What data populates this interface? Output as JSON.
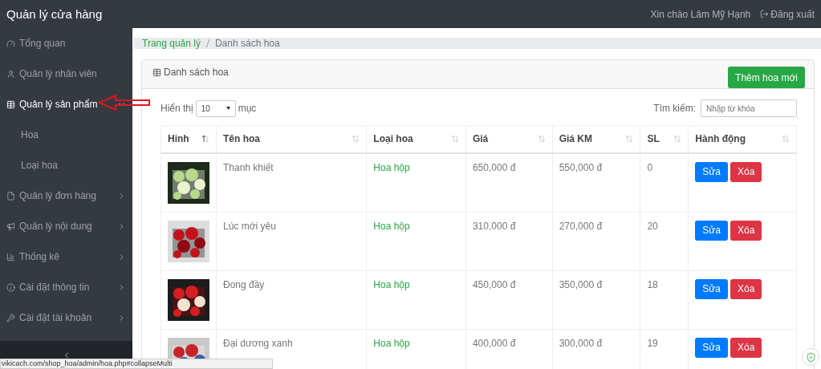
{
  "app": {
    "title": "Quản lý cửa hàng"
  },
  "top_bar": {
    "greeting": "Xin chào Lâm Mỹ Hạnh",
    "logout": "Đăng xuất"
  },
  "sidebar": {
    "items": [
      {
        "label": "Tổng quan",
        "kind": "link",
        "expanded": false
      },
      {
        "label": "Quản lý nhân viên",
        "kind": "link",
        "expanded": false
      },
      {
        "label": "Quản lý sản phẩm",
        "kind": "group",
        "expanded": true,
        "children": [
          {
            "label": "Hoa"
          },
          {
            "label": "Loại hoa"
          }
        ]
      },
      {
        "label": "Quản lý đơn hàng",
        "kind": "group",
        "expanded": false
      },
      {
        "label": "Quản lý nội dung",
        "kind": "group",
        "expanded": false
      },
      {
        "label": "Thống kê",
        "kind": "group",
        "expanded": false
      },
      {
        "label": "Cài đặt thông tin",
        "kind": "group",
        "expanded": false
      },
      {
        "label": "Cài đặt tài khoản",
        "kind": "group",
        "expanded": false
      }
    ]
  },
  "breadcrumb": [
    {
      "label": "Trang quản lý",
      "kind": "link"
    },
    {
      "label": "Danh sách hoa",
      "kind": "current"
    }
  ],
  "card": {
    "title": "Danh sách hoa",
    "add_button": "Thêm hoa mới"
  },
  "table_controls": {
    "show_label": "Hiển thị",
    "page_size": "10",
    "entries_label": "mục",
    "search_label": "Tìm kiếm:",
    "search_placeholder": "Nhập từ khóa"
  },
  "table": {
    "columns": [
      {
        "label": "Hinh",
        "sorted": true
      },
      {
        "label": "Tên hoa",
        "sorted": false
      },
      {
        "label": "Loại hoa",
        "sorted": false
      },
      {
        "label": "Giá",
        "sorted": false
      },
      {
        "label": "Giá KM",
        "sorted": false
      },
      {
        "label": "SL",
        "sorted": false
      },
      {
        "label": "Hành động",
        "sorted": false
      }
    ],
    "rows": [
      {
        "name": "Thanh khiết",
        "category": "Hoa hộp",
        "price": "650,000 đ",
        "sale_price": "550,000 đ",
        "quantity": "0",
        "actions": [
          {
            "label": "Sửa",
            "kind": "edit"
          },
          {
            "label": "Xóa",
            "kind": "delete"
          }
        ]
      },
      {
        "name": "Lúc mới yêu",
        "category": "Hoa hộp",
        "price": "310,000 đ",
        "sale_price": "270,000 đ",
        "quantity": "20",
        "actions": [
          {
            "label": "Sửa",
            "kind": "edit"
          },
          {
            "label": "Xóa",
            "kind": "delete"
          }
        ]
      },
      {
        "name": "Đong đầy",
        "category": "Hoa hộp",
        "price": "450,000 đ",
        "sale_price": "350,000 đ",
        "quantity": "18",
        "actions": [
          {
            "label": "Sửa",
            "kind": "edit"
          },
          {
            "label": "Xóa",
            "kind": "delete"
          }
        ]
      },
      {
        "name": "Đại dương xanh",
        "category": "Hoa hộp",
        "price": "400,000 đ",
        "sale_price": "300,000 đ",
        "quantity": "19",
        "actions": [
          {
            "label": "Sửa",
            "kind": "edit"
          },
          {
            "label": "Xóa",
            "kind": "delete"
          }
        ]
      }
    ]
  },
  "status_bar": {
    "url": "vikicach.com/shop_hoa/admin/hoa.php#collapseMulti"
  }
}
